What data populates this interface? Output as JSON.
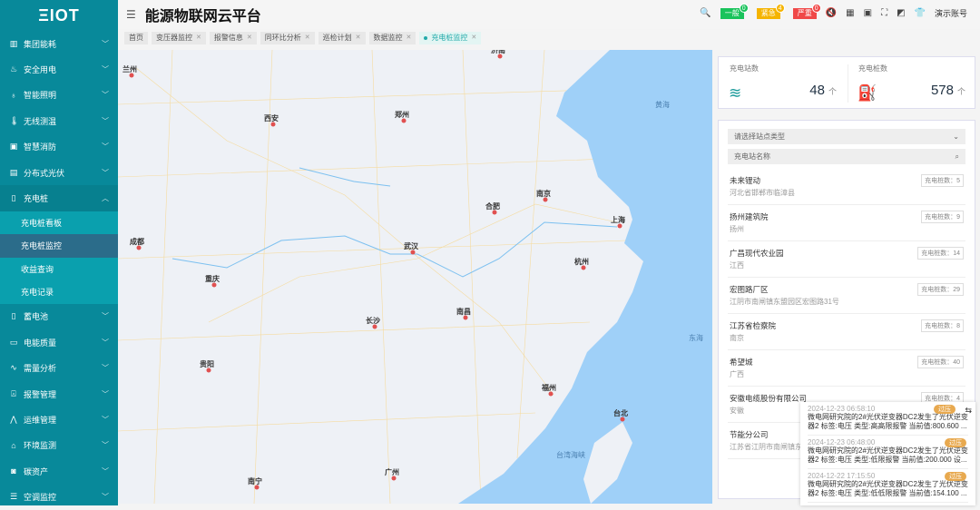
{
  "sidebar": {
    "logo": "ΞIOT",
    "items": [
      {
        "label": "集团能耗",
        "icon": "building-icon"
      },
      {
        "label": "安全用电",
        "icon": "flame-icon"
      },
      {
        "label": "智能照明",
        "icon": "bulb-icon"
      },
      {
        "label": "无线测温",
        "icon": "thermometer-icon"
      },
      {
        "label": "智慧消防",
        "icon": "monitor-icon"
      },
      {
        "label": "分布式光伏",
        "icon": "solar-icon"
      },
      {
        "label": "充电桩",
        "icon": "charger-icon"
      }
    ],
    "sub": [
      "充电桩看板",
      "充电桩监控",
      "收益查询",
      "充电记录"
    ],
    "items2": [
      {
        "label": "蓄电池",
        "icon": "battery-icon"
      },
      {
        "label": "电能质量",
        "icon": "meter-icon"
      },
      {
        "label": "需量分析",
        "icon": "chart-icon"
      },
      {
        "label": "报警管理",
        "icon": "alarm-icon"
      },
      {
        "label": "运维管理",
        "icon": "wave-icon"
      },
      {
        "label": "环境监测",
        "icon": "home-icon"
      },
      {
        "label": "碳资产",
        "icon": "carbon-icon"
      },
      {
        "label": "空调监控",
        "icon": "ac-icon"
      }
    ]
  },
  "header": {
    "title": "能源物联网云平台",
    "badges": [
      {
        "label": "一般",
        "count": "0",
        "color": "#19c35b"
      },
      {
        "label": "紧急",
        "count": "4",
        "color": "#f5b400"
      },
      {
        "label": "严重",
        "count": "0",
        "color": "#f04848"
      }
    ],
    "user": "演示账号"
  },
  "tabs": [
    "首页",
    "变压器监控",
    "报警信息",
    "同环比分析",
    "巡检计划",
    "数据监控",
    "充电桩监控"
  ],
  "map": {
    "cities": [
      "兰州",
      "西安",
      "郑州",
      "济南",
      "南京",
      "合肥",
      "上海",
      "武汉",
      "杭州",
      "成都",
      "重庆",
      "长沙",
      "南昌",
      "贵阳",
      "福州",
      "台北",
      "广州",
      "南宁"
    ],
    "seas": [
      "黄海",
      "东海",
      "台湾海峡"
    ]
  },
  "stats": {
    "stations_label": "充电站数",
    "stations": "48",
    "piles_label": "充电桩数",
    "piles": "578",
    "unit": "个"
  },
  "filters": {
    "type_placeholder": "请选择站点类型",
    "name_placeholder": "充电站名称"
  },
  "stations": [
    {
      "name": "未来锂动",
      "addr": "河北省邯郸市临漳县",
      "count": "充电桩数：5"
    },
    {
      "name": "扬州建筑院",
      "addr": "扬州",
      "count": "充电桩数：9"
    },
    {
      "name": "广昌现代农业园",
      "addr": "江西",
      "count": "充电桩数：14"
    },
    {
      "name": "宏图路厂区",
      "addr": "江阴市南闸镇东盟园区宏图路31号",
      "count": "充电桩数：29"
    },
    {
      "name": "江苏省检察院",
      "addr": "南京",
      "count": "充电桩数：8"
    },
    {
      "name": "希望城",
      "addr": "广西",
      "count": "充电桩数：40"
    },
    {
      "name": "安徽电缆股份有限公司",
      "addr": "安徽",
      "count": "充电桩数：4"
    },
    {
      "name": "节能分公司",
      "addr": "江苏省江阴市南闸镇东",
      "count": ""
    }
  ],
  "alerts": [
    {
      "time": "2024-12-23 06:58:10",
      "tag": "过压",
      "msg": "微电网研究院的2#光伏逆变器DC2发生了光伏逆变器2 标签:电压 类型:高高限报警 当前值:800.600 ..."
    },
    {
      "time": "2024-12-23 06:48:00",
      "tag": "过压",
      "msg": "微电网研究院的2#光伏逆变器DC2发生了光伏逆变器2 标签:电压 类型:低限报警 当前值:200.000 设..."
    },
    {
      "time": "2024-12-22 17:15:50",
      "tag": "过压",
      "msg": "微电网研究院的2#光伏逆变器DC2发生了光伏逆变器2 标签:电压 类型:低低限报警 当前值:154.100 ..."
    }
  ]
}
